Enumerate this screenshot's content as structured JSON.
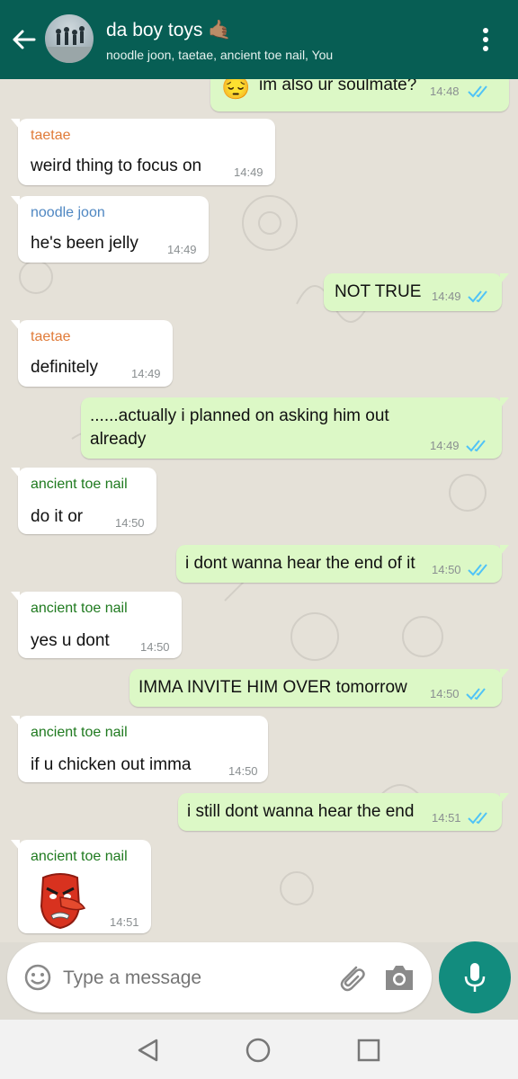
{
  "header": {
    "title": "da boy toys 🤙🏽",
    "subtitle": "noodle joon, taetae, ancient toe nail, You"
  },
  "colors": {
    "header": "#075e54",
    "incoming_bubble": "#ffffff",
    "outgoing_bubble": "#dcf8c6",
    "sender_taetae": "#e07b39",
    "sender_noodle_joon": "#4f87c2",
    "sender_ancient_toe_nail": "#1f7a1f",
    "read_ticks": "#4fc3f7",
    "send_button": "#128c7e"
  },
  "messages": [
    {
      "direction": "out",
      "emoji": "😔",
      "text": "im also ur soulmate?",
      "time": "14:48",
      "status": "read"
    },
    {
      "direction": "in",
      "sender": "taetae",
      "text": "weird thing to focus on",
      "time": "14:49"
    },
    {
      "direction": "in",
      "sender": "noodle joon",
      "text": "he's been jelly",
      "time": "14:49"
    },
    {
      "direction": "out",
      "text": "NOT TRUE",
      "time": "14:49",
      "status": "read"
    },
    {
      "direction": "in",
      "sender": "taetae",
      "text": "definitely",
      "time": "14:49"
    },
    {
      "direction": "out",
      "text_line1": "......actually i planned on asking him out",
      "text_line2": "already",
      "time": "14:49",
      "status": "read"
    },
    {
      "direction": "in",
      "sender": "ancient toe nail",
      "text": "do it or",
      "time": "14:50"
    },
    {
      "direction": "out",
      "text": "i dont wanna hear the end of it",
      "time": "14:50",
      "status": "read"
    },
    {
      "direction": "in",
      "sender": "ancient toe nail",
      "text": "yes u dont",
      "time": "14:50"
    },
    {
      "direction": "out",
      "text": "IMMA INVITE HIM OVER tomorrow",
      "time": "14:50",
      "status": "read"
    },
    {
      "direction": "in",
      "sender": "ancient toe nail",
      "text": "if u chicken out imma",
      "time": "14:50"
    },
    {
      "direction": "out",
      "text": "i still dont wanna hear the end",
      "time": "14:51",
      "status": "read"
    },
    {
      "direction": "in",
      "sender": "ancient toe nail",
      "sticker": "angry-tengu-mask-sticker",
      "time": "14:51"
    }
  ],
  "composer": {
    "placeholder": "Type a message",
    "icons": [
      "emoji-icon",
      "attach-icon",
      "camera-icon",
      "mic-icon"
    ]
  },
  "navbar": {
    "icons": [
      "back-triangle-icon",
      "home-circle-icon",
      "recents-square-icon"
    ]
  }
}
